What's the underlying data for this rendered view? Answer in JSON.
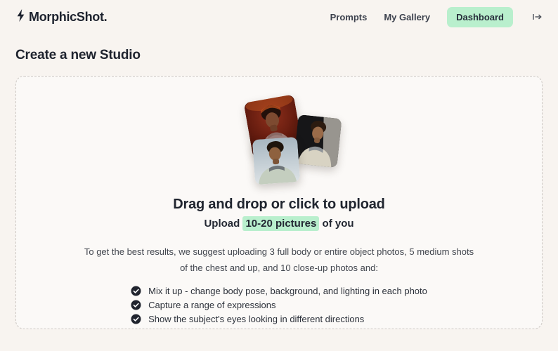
{
  "header": {
    "logo": {
      "text": "MorphicShot.",
      "icon": "bolt-icon"
    },
    "nav": [
      {
        "label": "Prompts",
        "active": false
      },
      {
        "label": "My Gallery",
        "active": false
      },
      {
        "label": "Dashboard",
        "active": true
      }
    ],
    "logout_icon": "logout-icon"
  },
  "main": {
    "title": "Create a new Studio",
    "dropzone": {
      "heading": "Drag and drop or click to upload",
      "subtitle": {
        "prefix": "Upload ",
        "highlight": "10-20 pictures",
        "suffix": " of you"
      },
      "description": "To get the best results, we suggest uploading 3 full body or entire object photos, 5 medium shots of the chest and up, and 10 close-up photos and:",
      "checklist": [
        "Mix it up - change body pose, background, and lighting in each photo",
        "Capture a range of expressions",
        "Show the subject's eyes looking in different directions"
      ],
      "photos": [
        {
          "name": "sample-photo-red-background"
        },
        {
          "name": "sample-photo-dark-background"
        },
        {
          "name": "sample-photo-sky-background"
        }
      ]
    }
  },
  "colors": {
    "page_bg": "#f8f4f0",
    "dropzone_bg": "#fbf9f7",
    "dashed_border": "#ccc7c3",
    "accent_mint": "#b9efcd",
    "text_dark": "#20252f",
    "text_gray": "#43474f"
  }
}
